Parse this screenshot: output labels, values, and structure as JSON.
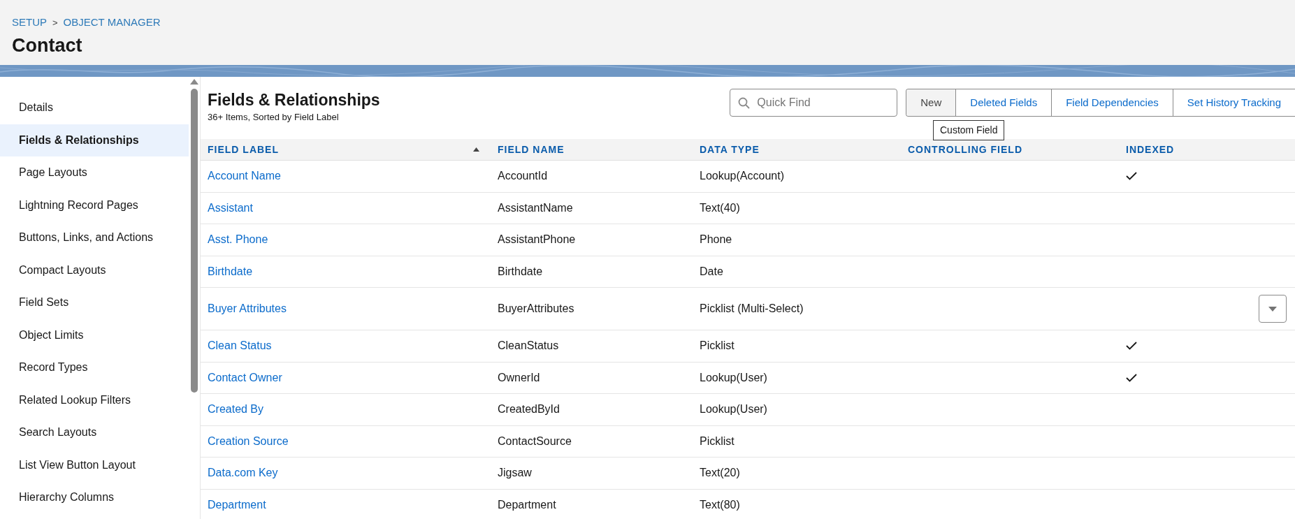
{
  "breadcrumbs": [
    "SETUP",
    "OBJECT MANAGER"
  ],
  "breadcrumb_separator": ">",
  "object_title": "Contact",
  "sidebar": {
    "items": [
      {
        "label": "Details",
        "selected": false
      },
      {
        "label": "Fields & Relationships",
        "selected": true
      },
      {
        "label": "Page Layouts",
        "selected": false
      },
      {
        "label": "Lightning Record Pages",
        "selected": false
      },
      {
        "label": "Buttons, Links, and Actions",
        "selected": false
      },
      {
        "label": "Compact Layouts",
        "selected": false
      },
      {
        "label": "Field Sets",
        "selected": false
      },
      {
        "label": "Object Limits",
        "selected": false
      },
      {
        "label": "Record Types",
        "selected": false
      },
      {
        "label": "Related Lookup Filters",
        "selected": false
      },
      {
        "label": "Search Layouts",
        "selected": false
      },
      {
        "label": "List View Button Layout",
        "selected": false
      },
      {
        "label": "Hierarchy Columns",
        "selected": false
      }
    ]
  },
  "section": {
    "title": "Fields & Relationships",
    "subtitle": "36+ Items, Sorted by Field Label"
  },
  "search": {
    "placeholder": "Quick Find"
  },
  "buttons": [
    {
      "label": "New",
      "hovered": true
    },
    {
      "label": "Deleted Fields",
      "hovered": false
    },
    {
      "label": "Field Dependencies",
      "hovered": false
    },
    {
      "label": "Set History Tracking",
      "hovered": false
    }
  ],
  "tooltip": "Custom Field",
  "table": {
    "columns": [
      {
        "label": "FIELD LABEL",
        "sorted": true
      },
      {
        "label": "FIELD NAME",
        "sorted": false
      },
      {
        "label": "DATA TYPE",
        "sorted": false
      },
      {
        "label": "CONTROLLING FIELD",
        "sorted": false
      },
      {
        "label": "INDEXED",
        "sorted": false
      }
    ],
    "rows": [
      {
        "field_label": "Account Name",
        "field_name": "AccountId",
        "data_type": "Lookup(Account)",
        "indexed": true,
        "menu_button": false
      },
      {
        "field_label": "Assistant",
        "field_name": "AssistantName",
        "data_type": "Text(40)",
        "indexed": false,
        "menu_button": false
      },
      {
        "field_label": "Asst. Phone",
        "field_name": "AssistantPhone",
        "data_type": "Phone",
        "indexed": false,
        "menu_button": false
      },
      {
        "field_label": "Birthdate",
        "field_name": "Birthdate",
        "data_type": "Date",
        "indexed": false,
        "menu_button": false
      },
      {
        "field_label": "Buyer Attributes",
        "field_name": "BuyerAttributes",
        "data_type": "Picklist (Multi-Select)",
        "indexed": false,
        "menu_button": true
      },
      {
        "field_label": "Clean Status",
        "field_name": "CleanStatus",
        "data_type": "Picklist",
        "indexed": true,
        "menu_button": false
      },
      {
        "field_label": "Contact Owner",
        "field_name": "OwnerId",
        "data_type": "Lookup(User)",
        "indexed": true,
        "menu_button": false
      },
      {
        "field_label": "Created By",
        "field_name": "CreatedById",
        "data_type": "Lookup(User)",
        "indexed": false,
        "menu_button": false
      },
      {
        "field_label": "Creation Source",
        "field_name": "ContactSource",
        "data_type": "Picklist",
        "indexed": false,
        "menu_button": false
      },
      {
        "field_label": "Data.com Key",
        "field_name": "Jigsaw",
        "data_type": "Text(20)",
        "indexed": false,
        "menu_button": false
      },
      {
        "field_label": "Department",
        "field_name": "Department",
        "data_type": "Text(80)",
        "indexed": false,
        "menu_button": false
      }
    ]
  }
}
